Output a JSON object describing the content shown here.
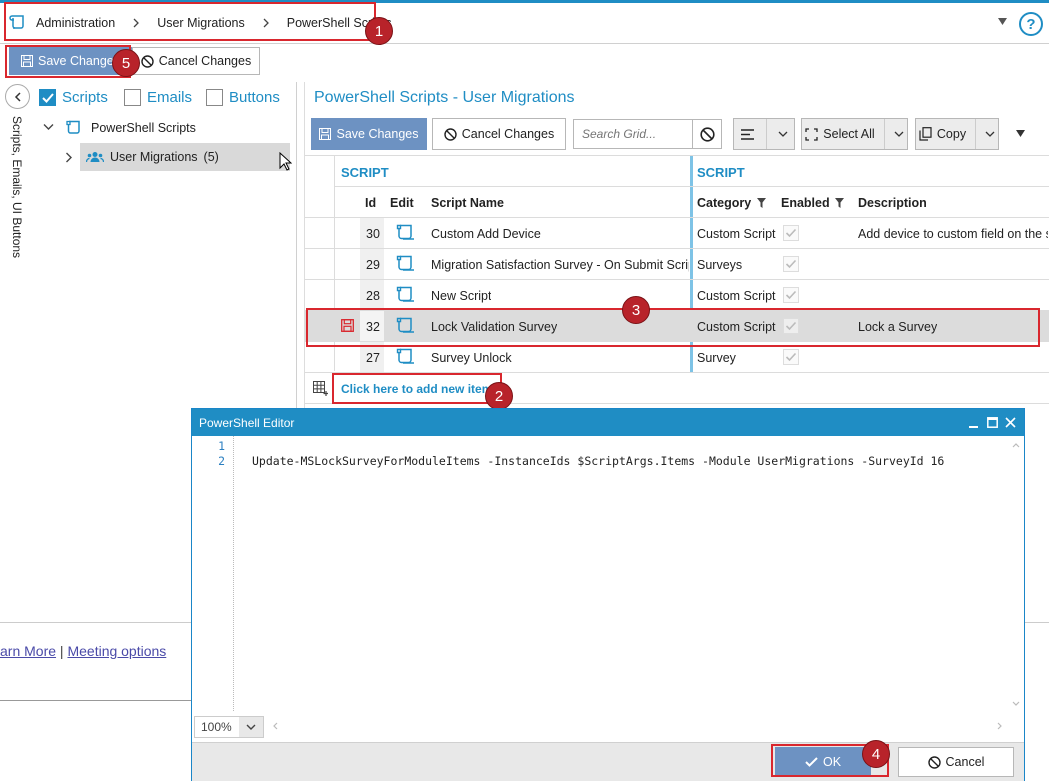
{
  "breadcrumb": {
    "items": [
      "Administration",
      "User Migrations",
      "PowerShell Scripts"
    ]
  },
  "toolbar": {
    "save_label": "Save Changes",
    "cancel_label": "Cancel Changes"
  },
  "left_panel": {
    "vertical_label": "Scripts, Emails, UI Buttons",
    "filters": [
      {
        "label": "Scripts",
        "checked": true
      },
      {
        "label": "Emails",
        "checked": false
      },
      {
        "label": "Buttons",
        "checked": false
      }
    ],
    "tree": {
      "root": "PowerShell Scripts",
      "child": "User Migrations",
      "child_count": "(5)"
    }
  },
  "grid": {
    "title": "PowerShell Scripts - User Migrations",
    "save_label": "Save Changes",
    "cancel_label": "Cancel Changes",
    "search_placeholder": "Search Grid...",
    "select_all_label": "Select All",
    "copy_label": "Copy",
    "group_headers": [
      "SCRIPT",
      "SCRIPT"
    ],
    "columns": {
      "id": "Id",
      "edit": "Edit",
      "name": "Script Name",
      "category": "Category",
      "enabled": "Enabled",
      "description": "Description"
    },
    "rows": [
      {
        "id": "30",
        "name": "Custom Add Device",
        "category": "Custom Script",
        "enabled": true,
        "description": "Add device to custom field on the s"
      },
      {
        "id": "29",
        "name": "Migration Satisfaction Survey - On Submit Script",
        "category": "Surveys",
        "enabled": true,
        "description": ""
      },
      {
        "id": "28",
        "name": "New Script",
        "category": "Custom Script",
        "enabled": true,
        "description": ""
      },
      {
        "id": "32",
        "name": "Lock Validation Survey",
        "category": "Custom Script",
        "enabled": true,
        "description": "Lock a Survey",
        "dirty": true
      },
      {
        "id": "27",
        "name": "Survey Unlock",
        "category": "Survey",
        "enabled": true,
        "description": ""
      }
    ],
    "add_item_label": "Click here to add new item"
  },
  "background": {
    "learn_more": "arn More",
    "separator": "|",
    "meeting_options": "Meeting options"
  },
  "editor": {
    "title": "PowerShell Editor",
    "line_numbers": [
      "1",
      "2"
    ],
    "lines": [
      "",
      "Update-MSLockSurveyForModuleItems -InstanceIds $ScriptArgs.Items -Module UserMigrations -SurveyId 16"
    ],
    "zoom": "100%",
    "ok_label": "OK",
    "cancel_label": "Cancel"
  },
  "annotations": [
    "1",
    "2",
    "3",
    "4",
    "5"
  ],
  "colors": {
    "accent": "#1f8dc4",
    "primary_button": "#6d92c2",
    "annotation": "#d9272e"
  }
}
